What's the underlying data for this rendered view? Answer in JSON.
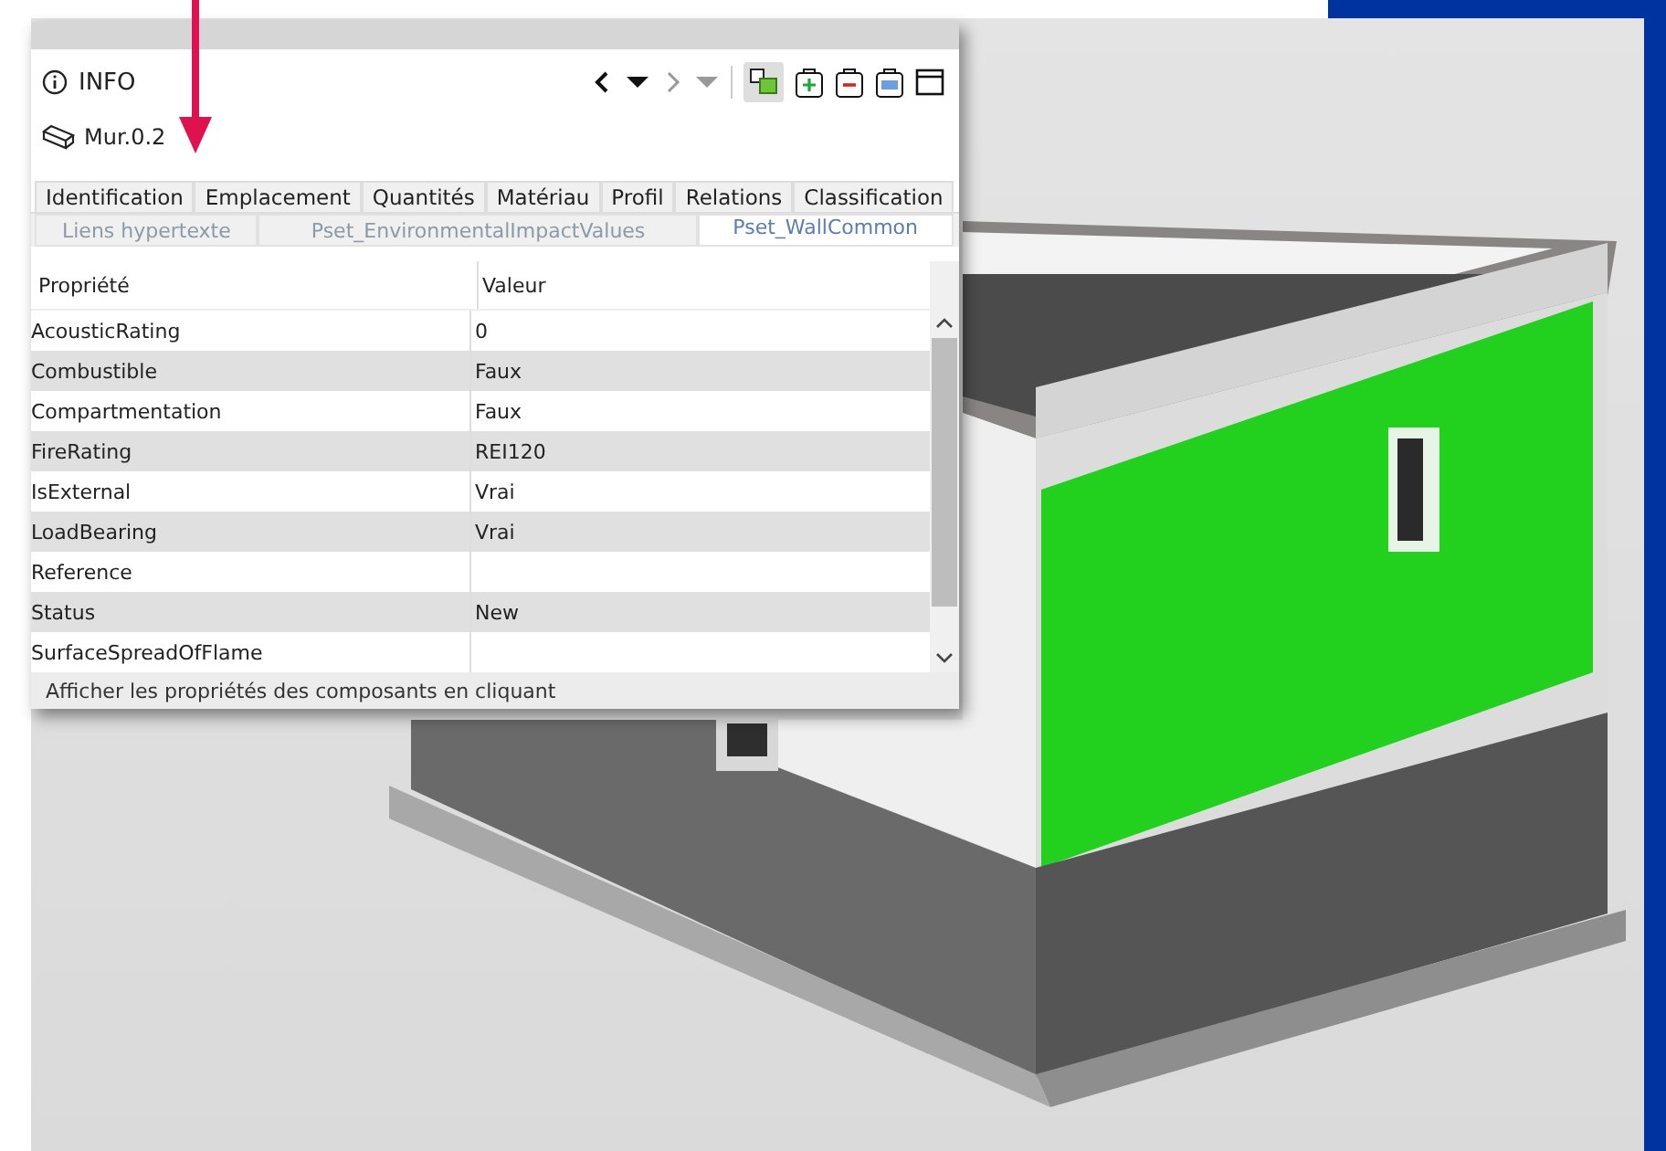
{
  "panel": {
    "title": "INFO",
    "element": "Mur.0.2",
    "tabs_row_1": [
      {
        "label": "Identification",
        "selected": false
      },
      {
        "label": "Emplacement",
        "selected": false
      },
      {
        "label": "Quantités",
        "selected": false
      },
      {
        "label": "Matériau",
        "selected": false
      },
      {
        "label": "Profil",
        "selected": false
      },
      {
        "label": "Relations",
        "selected": false
      },
      {
        "label": "Classification",
        "selected": false
      }
    ],
    "tabs_row_2": [
      {
        "label": "Liens hypertexte",
        "selected": false
      },
      {
        "label": "Pset_EnvironmentalImpactValues",
        "selected": false
      },
      {
        "label": "Pset_WallCommon",
        "selected": true
      }
    ],
    "table": {
      "columns": [
        "Propriété",
        "Valeur"
      ],
      "rows": [
        {
          "property": "AcousticRating",
          "value": "0"
        },
        {
          "property": "Combustible",
          "value": "Faux"
        },
        {
          "property": "Compartmentation",
          "value": "Faux"
        },
        {
          "property": "FireRating",
          "value": "REI120"
        },
        {
          "property": "IsExternal",
          "value": "Vrai"
        },
        {
          "property": "LoadBearing",
          "value": "Vrai"
        },
        {
          "property": "Reference",
          "value": ""
        },
        {
          "property": "Status",
          "value": "New"
        },
        {
          "property": "SurfaceSpreadOfFlame",
          "value": ""
        }
      ]
    },
    "status_bar": "Afficher les propriétés des composants en cliquant"
  }
}
